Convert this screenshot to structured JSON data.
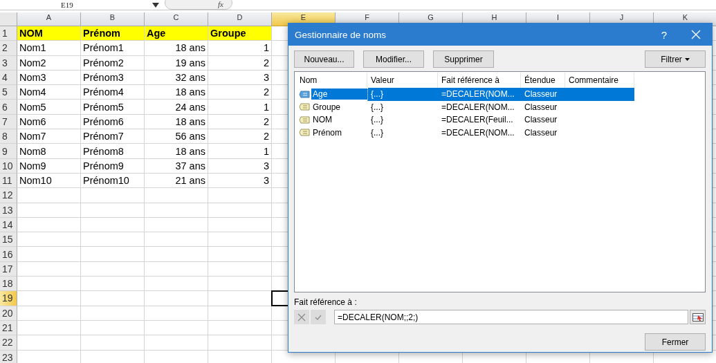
{
  "formula_bar": {
    "name_box": "E19",
    "function_label": "fx"
  },
  "sheet": {
    "columns": [
      {
        "label": "A",
        "selected": false,
        "numeric": false
      },
      {
        "label": "B",
        "selected": false,
        "numeric": false
      },
      {
        "label": "C",
        "selected": false,
        "numeric": true
      },
      {
        "label": "D",
        "selected": false,
        "numeric": true
      },
      {
        "label": "E",
        "selected": true
      },
      {
        "label": "F",
        "selected": false
      },
      {
        "label": "G",
        "selected": false
      },
      {
        "label": "H",
        "selected": false
      },
      {
        "label": "I",
        "selected": false
      },
      {
        "label": "J",
        "selected": false
      },
      {
        "label": "K",
        "selected": false
      }
    ],
    "rows": [
      {
        "label": "1",
        "selected": false,
        "kind": "header",
        "cells": [
          "NOM",
          "Prénom",
          "Age",
          "Groupe"
        ]
      },
      {
        "label": "2",
        "selected": false,
        "kind": "data",
        "cells": [
          "Nom1",
          "Prénom1",
          "18 ans",
          "1"
        ]
      },
      {
        "label": "3",
        "selected": false,
        "kind": "data",
        "cells": [
          "Nom2",
          "Prénom2",
          "19 ans",
          "2"
        ]
      },
      {
        "label": "4",
        "selected": false,
        "kind": "data",
        "cells": [
          "Nom3",
          "Prénom3",
          "32 ans",
          "3"
        ]
      },
      {
        "label": "5",
        "selected": false,
        "kind": "data",
        "cells": [
          "Nom4",
          "Prénom4",
          "18 ans",
          "2"
        ]
      },
      {
        "label": "6",
        "selected": false,
        "kind": "data",
        "cells": [
          "Nom5",
          "Prénom5",
          "24 ans",
          "1"
        ]
      },
      {
        "label": "7",
        "selected": false,
        "kind": "data",
        "cells": [
          "Nom6",
          "Prénom6",
          "18 ans",
          "2"
        ]
      },
      {
        "label": "8",
        "selected": false,
        "kind": "data",
        "cells": [
          "Nom7",
          "Prénom7",
          "56 ans",
          "2"
        ]
      },
      {
        "label": "9",
        "selected": false,
        "kind": "data",
        "cells": [
          "Nom8",
          "Prénom8",
          "18 ans",
          "1"
        ]
      },
      {
        "label": "10",
        "selected": false,
        "kind": "data",
        "cells": [
          "Nom9",
          "Prénom9",
          "37 ans",
          "3"
        ]
      },
      {
        "label": "11",
        "selected": false,
        "kind": "data",
        "cells": [
          "Nom10",
          "Prénom10",
          "21 ans",
          "3"
        ]
      },
      {
        "label": "12",
        "selected": false,
        "kind": "data",
        "cells": []
      },
      {
        "label": "13",
        "selected": false,
        "kind": "data",
        "cells": []
      },
      {
        "label": "14",
        "selected": false,
        "kind": "data",
        "cells": []
      },
      {
        "label": "15",
        "selected": false,
        "kind": "data",
        "cells": []
      },
      {
        "label": "16",
        "selected": false,
        "kind": "data",
        "cells": []
      },
      {
        "label": "17",
        "selected": false,
        "kind": "data",
        "cells": []
      },
      {
        "label": "18",
        "selected": false,
        "kind": "data",
        "cells": []
      },
      {
        "label": "19",
        "selected": true,
        "kind": "data",
        "cells": []
      },
      {
        "label": "20",
        "selected": false,
        "kind": "data",
        "cells": []
      },
      {
        "label": "21",
        "selected": false,
        "kind": "data",
        "cells": []
      },
      {
        "label": "22",
        "selected": false,
        "kind": "data",
        "cells": []
      },
      {
        "label": "23",
        "selected": false,
        "kind": "data",
        "cells": []
      }
    ]
  },
  "dialog": {
    "title": "Gestionnaire de noms",
    "help": "?",
    "buttons": [
      "Nouveau...",
      "Modifier...",
      "Supprimer"
    ],
    "filter": "Filtrer",
    "list_columns": [
      "Nom",
      "Valeur",
      "Fait référence à",
      "Étendue",
      "Commentaire"
    ],
    "names": [
      {
        "name": "Age",
        "value": "{...}",
        "refers_to": "=DECALER(NOM...",
        "scope": "Classeur",
        "selected": true
      },
      {
        "name": "Groupe",
        "value": "{...}",
        "refers_to": "=DECALER(NOM...",
        "scope": "Classeur",
        "selected": false
      },
      {
        "name": "NOM",
        "value": "{...}",
        "refers_to": "=DECALER(Feuil...",
        "scope": "Classeur",
        "selected": false
      },
      {
        "name": "Prénom",
        "value": "{...}",
        "refers_to": "=DECALER(NOM...",
        "scope": "Classeur",
        "selected": false
      }
    ],
    "refers_label": "Fait référence à :",
    "refers_value": "=DECALER(NOM;;2;)",
    "close": "Fermer"
  }
}
